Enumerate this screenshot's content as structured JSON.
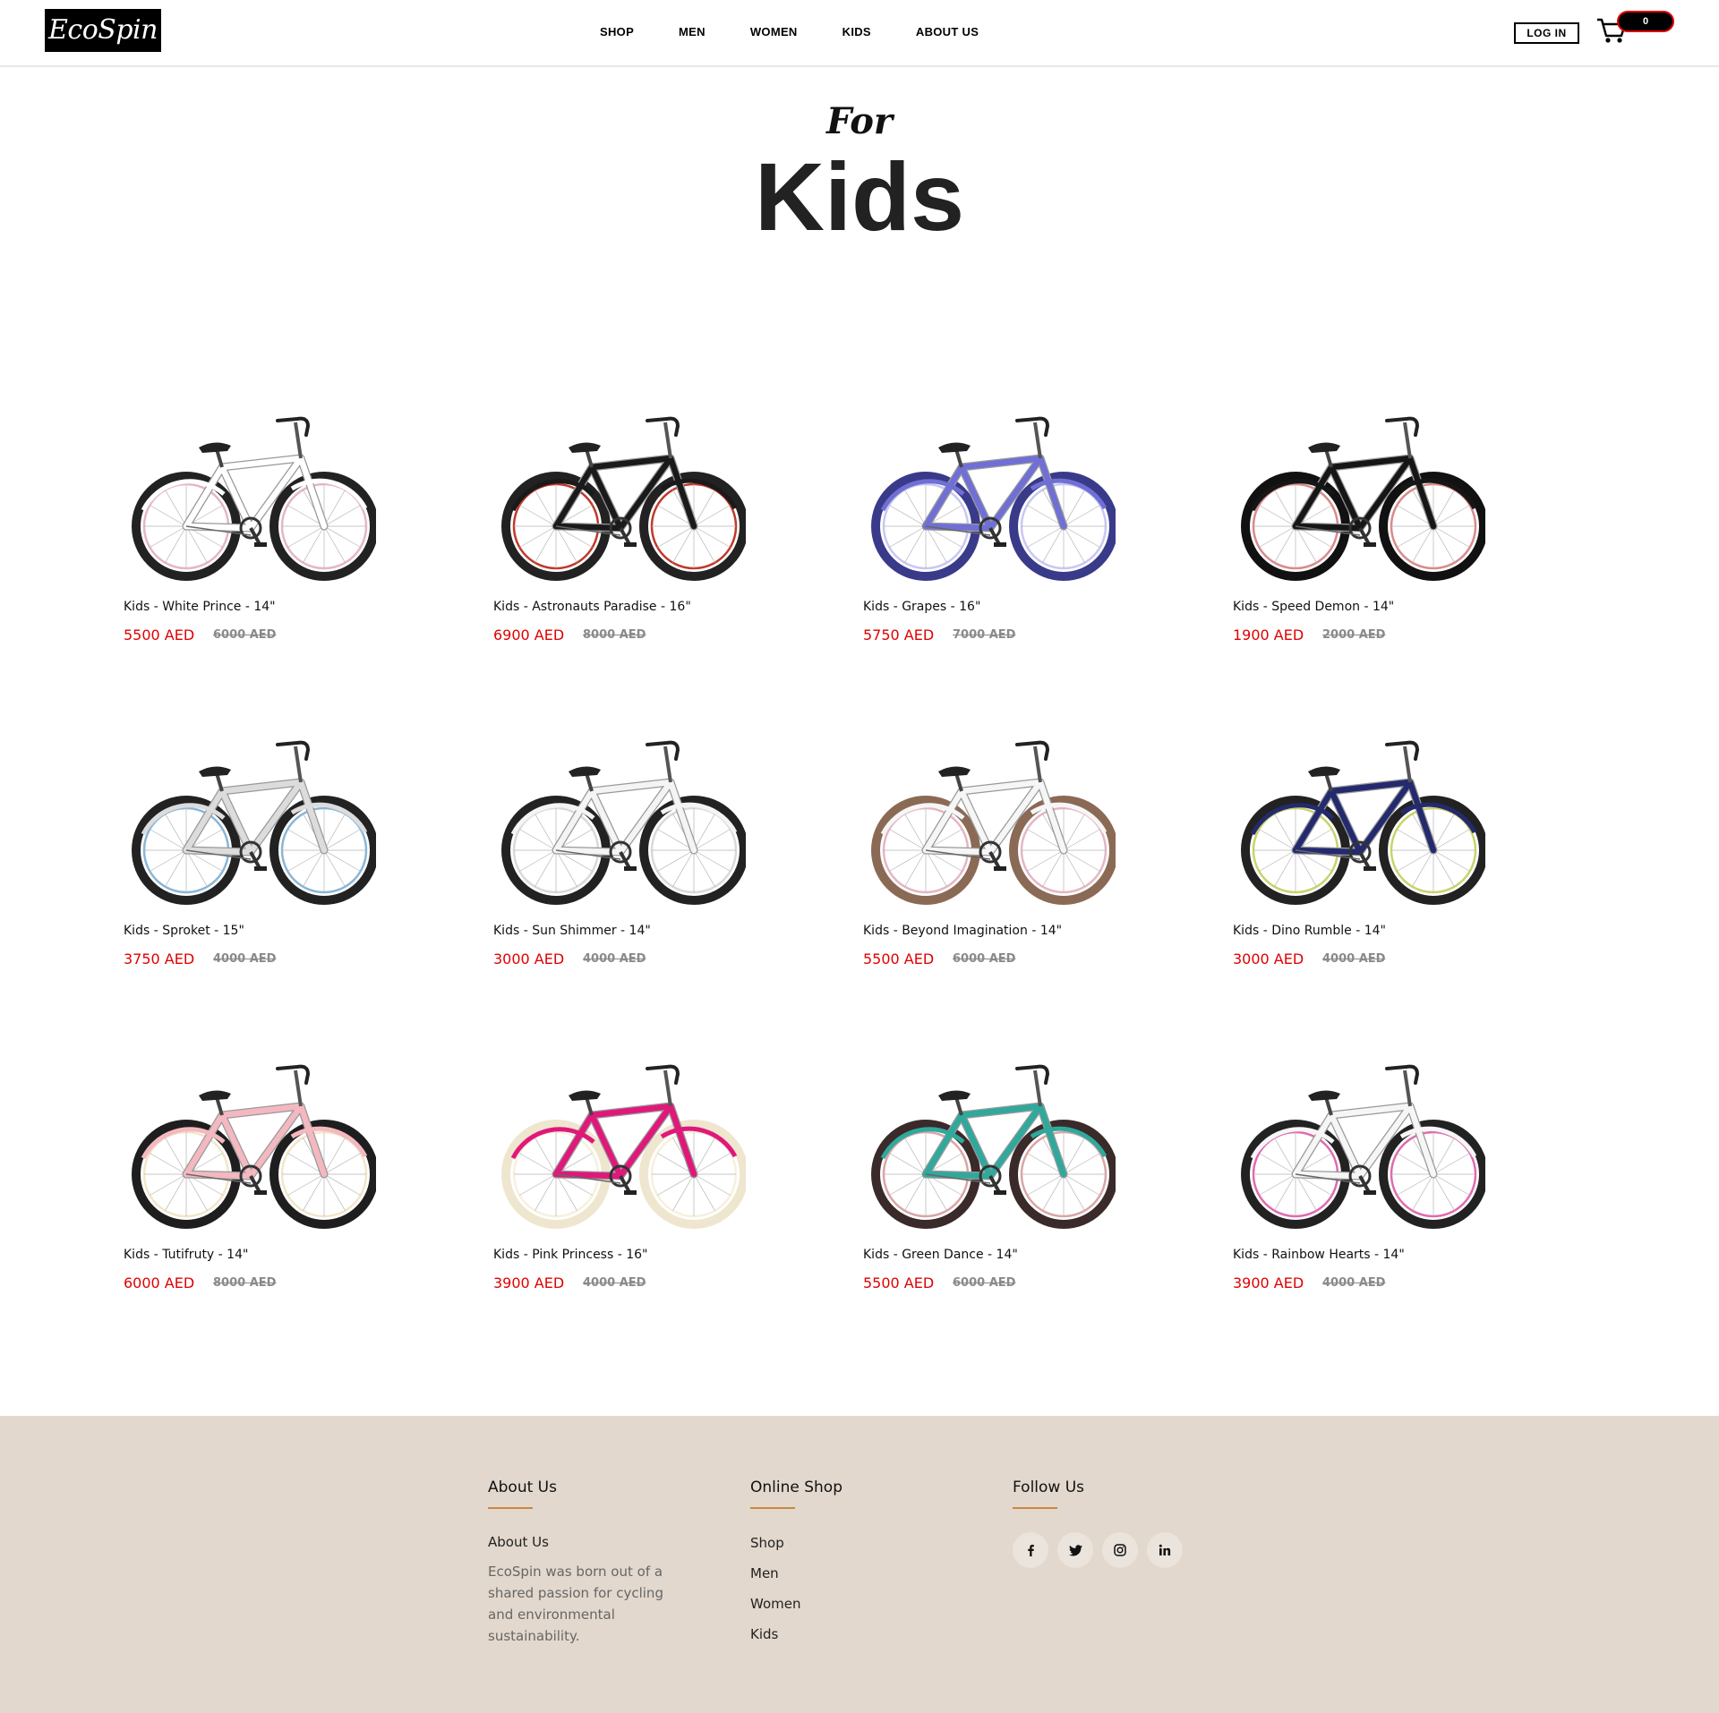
{
  "brand": {
    "logo_text": "EcoSpin"
  },
  "nav": {
    "items": [
      {
        "label": "SHOP"
      },
      {
        "label": "MEN"
      },
      {
        "label": "WOMEN"
      },
      {
        "label": "KIDS"
      },
      {
        "label": "ABOUT US"
      }
    ],
    "login_label": "LOG IN",
    "cart_count": "0"
  },
  "hero": {
    "prefix": "For",
    "title": "Kids"
  },
  "products": [
    {
      "name": "Kids - White Prince - 14\"",
      "price": "5500 AED",
      "old_price": "6000 AED",
      "frame": "#ffffff",
      "tire": "#222222",
      "rim": "#e4b6c4"
    },
    {
      "name": "Kids - Astronauts Paradise - 16\"",
      "price": "6900 AED",
      "old_price": "8000 AED",
      "frame": "#1a1a1a",
      "tire": "#222222",
      "rim": "#c0392b"
    },
    {
      "name": "Kids - Grapes - 16\"",
      "price": "5750 AED",
      "old_price": "7000 AED",
      "frame": "#6f6fd6",
      "tire": "#3a3a8a",
      "rim": "#c8c8f0"
    },
    {
      "name": "Kids - Speed Demon - 14\"",
      "price": "1900 AED",
      "old_price": "2000 AED",
      "frame": "#161616",
      "tire": "#111111",
      "rim": "#d98a8a"
    },
    {
      "name": "Kids - Sproket - 15\"",
      "price": "3750 AED",
      "old_price": "4000 AED",
      "frame": "#dcdcdc",
      "tire": "#222222",
      "rim": "#8ab6d6"
    },
    {
      "name": "Kids - Sun Shimmer - 14\"",
      "price": "3000 AED",
      "old_price": "4000 AED",
      "frame": "#f4f4f4",
      "tire": "#222222",
      "rim": "#d9d9d9"
    },
    {
      "name": "Kids - Beyond Imagination - 14\"",
      "price": "5500 AED",
      "old_price": "6000 AED",
      "frame": "#f6f6f6",
      "tire": "#8a6a55",
      "rim": "#e4b6c4"
    },
    {
      "name": "Kids - Dino Rumble - 14\"",
      "price": "3000 AED",
      "old_price": "4000 AED",
      "frame": "#242a6e",
      "tire": "#222222",
      "rim": "#c9d36a"
    },
    {
      "name": "Kids - Tutifruty - 14\"",
      "price": "6000 AED",
      "old_price": "8000 AED",
      "frame": "#f4b8c0",
      "tire": "#1e1e1e",
      "rim": "#f1e6c8"
    },
    {
      "name": "Kids - Pink Princess - 16\"",
      "price": "3900 AED",
      "old_price": "4000 AED",
      "frame": "#e0187a",
      "tire": "#efe6cf",
      "rim": "#f6f0de"
    },
    {
      "name": "Kids - Green Dance - 14\"",
      "price": "5500 AED",
      "old_price": "6000 AED",
      "frame": "#2fa99c",
      "tire": "#3a2a2a",
      "rim": "#d9a5a5"
    },
    {
      "name": "Kids - Rainbow Hearts - 14\"",
      "price": "3900 AED",
      "old_price": "4000 AED",
      "frame": "#f6f6f6",
      "tire": "#222222",
      "rim": "#e06ab0"
    }
  ],
  "footer": {
    "about": {
      "heading": "About Us",
      "link": "About Us",
      "text": "EcoSpin was born out of a shared passion for cycling and environmental sustainability."
    },
    "shop": {
      "heading": "Online Shop",
      "links": [
        "Shop",
        "Men",
        "Women",
        "Kids"
      ]
    },
    "follow": {
      "heading": "Follow Us",
      "icons": [
        {
          "name": "facebook-icon",
          "glyph": "f"
        },
        {
          "name": "twitter-icon",
          "glyph": "🐦"
        },
        {
          "name": "instagram-icon",
          "glyph": "◎"
        },
        {
          "name": "linkedin-icon",
          "glyph": "in"
        }
      ]
    }
  },
  "colors": {
    "price": "#e00000",
    "footer_bg": "#e2d8cd",
    "accent": "#c8893d"
  }
}
